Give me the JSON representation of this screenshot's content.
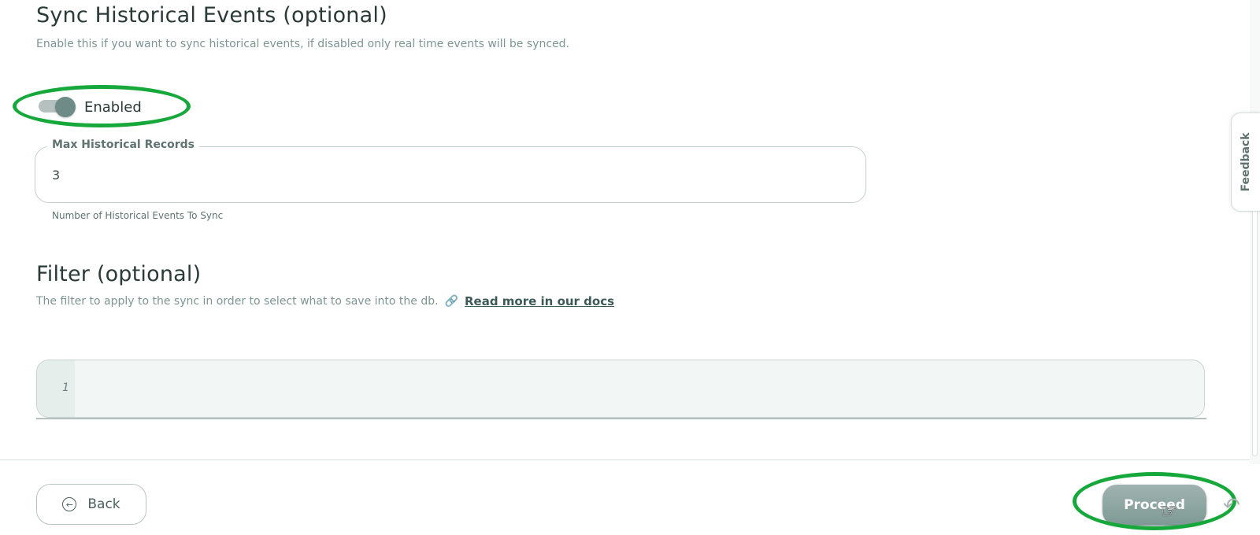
{
  "historical": {
    "title": "Sync Historical Events (optional)",
    "description": "Enable this if you want to sync historical events, if disabled only real time events will be synced.",
    "toggle": {
      "label": "Enabled",
      "checked": true
    },
    "max_records": {
      "label": "Max Historical Records",
      "value": "3",
      "helper": "Number of Historical Events To Sync"
    }
  },
  "filter": {
    "title": "Filter (optional)",
    "description": "The filter to apply to the sync in order to select what to save into the db.",
    "docs_link": "Read more in our docs",
    "editor": {
      "line_numbers": [
        "1"
      ],
      "content": ""
    }
  },
  "footer": {
    "back_label": "Back",
    "proceed_label": "Proceed"
  },
  "feedback": {
    "label": "Feedback"
  },
  "icons": {
    "link": "link-icon",
    "back": "arrow-left-circle-icon",
    "cursor": "hand-pointer-icon"
  },
  "colors": {
    "annotation": "#16a83a",
    "toggle_on": "#6f8b87",
    "primary_button": "#8aa39f"
  }
}
